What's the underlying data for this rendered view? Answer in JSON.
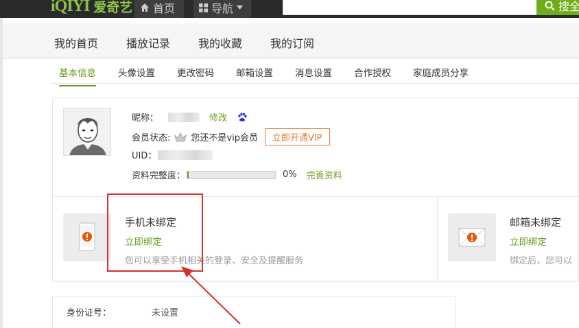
{
  "topbar": {
    "logo_mark": "iQIYI",
    "logo_text": "爱奇艺",
    "home_label": "首页",
    "nav_label": "导航",
    "search_label": "搜全"
  },
  "main_nav": [
    "我的首页",
    "播放记录",
    "我的收藏",
    "我的订阅"
  ],
  "sub_nav": [
    {
      "label": "基本信息",
      "active": true
    },
    {
      "label": "头像设置"
    },
    {
      "label": "更改密码"
    },
    {
      "label": "邮箱设置"
    },
    {
      "label": "消息设置"
    },
    {
      "label": "合作授权"
    },
    {
      "label": "家庭成员分享"
    }
  ],
  "profile": {
    "nickname_label": "昵称：",
    "modify_link": "修改",
    "member_label": "会员状态:",
    "member_status": "您还不是vip会员",
    "vip_button": "立即开通VIP",
    "uid_label": "UID：",
    "completeness_label": "资料完整度：",
    "completeness_value": "0%",
    "completeness_fraction": 0.01,
    "complete_link": "完善资料"
  },
  "phone_bind": {
    "title": "手机未绑定",
    "link": "立即绑定",
    "desc": "您可以享受手机相关的登录、安全及提醒服务"
  },
  "email_bind": {
    "title": "邮箱未绑定",
    "link": "立即绑定",
    "desc": "绑定后，您可以"
  },
  "id_card": {
    "label": "身份证号：",
    "value": "未设置"
  },
  "colors": {
    "accent_green": "#6a9d1e",
    "vip_orange": "#e07b39",
    "annotation_red": "#d32f2f",
    "warning_orange": "#e8580c"
  }
}
